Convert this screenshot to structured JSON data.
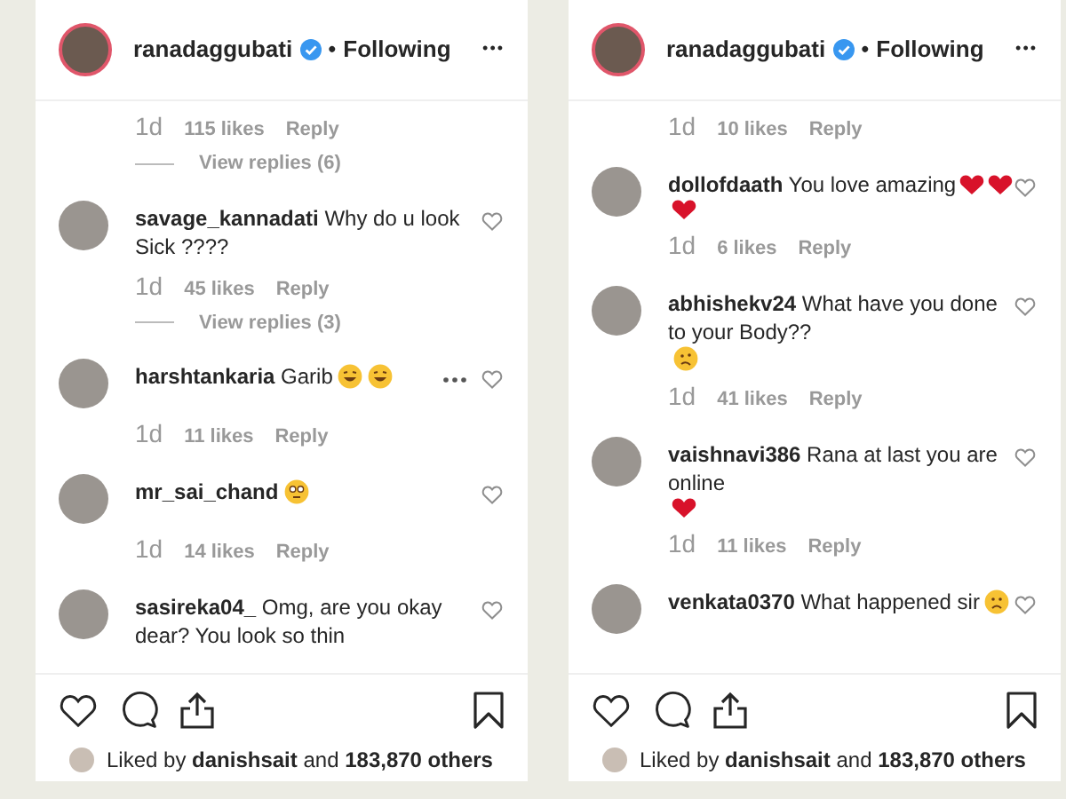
{
  "panels": [
    {
      "header": {
        "username": "ranadaggubati",
        "separator": "•",
        "follow": "Following",
        "more": "•••"
      },
      "comments": [
        {
          "kind": "meta",
          "time": "1d",
          "likes": "115 likes",
          "reply": "Reply",
          "view_replies": "View replies (6)"
        },
        {
          "kind": "comment",
          "text": "**savage_kannadati** Why do u look Sick ????",
          "options": false
        },
        {
          "kind": "meta",
          "time": "1d",
          "likes": "45 likes",
          "reply": "Reply",
          "view_replies": "View replies (3)"
        },
        {
          "kind": "comment",
          "text": "**harshtankaria** Garib",
          "emojis": [
            {
              "kind": "laugh"
            },
            {
              "kind": "laugh"
            }
          ],
          "options": true
        },
        {
          "kind": "meta",
          "time": "1d",
          "likes": "11 likes",
          "reply": "Reply"
        },
        {
          "kind": "comment",
          "text": "**mr_sai_chand**",
          "emojis": [
            {
              "kind": "flushed"
            }
          ],
          "options": false
        },
        {
          "kind": "meta",
          "time": "1d",
          "likes": "14 likes",
          "reply": "Reply"
        },
        {
          "kind": "comment",
          "text": "**sasireka04_** Omg, are you okay dear? You look so thin",
          "options": false
        }
      ],
      "liked_by": "Liked by **danishsait** and **183,870 others**"
    },
    {
      "header": {
        "username": "ranadaggubati",
        "separator": "•",
        "follow": "Following",
        "more": "•••"
      },
      "comments": [
        {
          "kind": "meta",
          "time": "1d",
          "likes": "10 likes",
          "reply": "Reply"
        },
        {
          "kind": "comment",
          "text": "**dollofdaath** You love amazing",
          "emojis": [
            {
              "kind": "heart"
            },
            {
              "kind": "heart"
            },
            {
              "kind": "heart"
            }
          ],
          "options": false
        },
        {
          "kind": "meta",
          "time": "1d",
          "likes": "6 likes",
          "reply": "Reply"
        },
        {
          "kind": "comment",
          "text": "**abhishekv24** What have you done to your Body??",
          "emojis": [
            {
              "kind": "confused"
            }
          ],
          "options": false
        },
        {
          "kind": "meta",
          "time": "1d",
          "likes": "41 likes",
          "reply": "Reply"
        },
        {
          "kind": "comment",
          "text": "**vaishnavi386** Rana at last you are online",
          "emojis": [
            {
              "kind": "heart"
            }
          ],
          "options": false
        },
        {
          "kind": "meta",
          "time": "1d",
          "likes": "11 likes",
          "reply": "Reply"
        },
        {
          "kind": "comment",
          "text": "**venkata0370** What happened sir",
          "emojis": [
            {
              "kind": "sad"
            }
          ],
          "options": false
        }
      ],
      "liked_by": "Liked by **danishsait** and **183,870 others**"
    }
  ]
}
